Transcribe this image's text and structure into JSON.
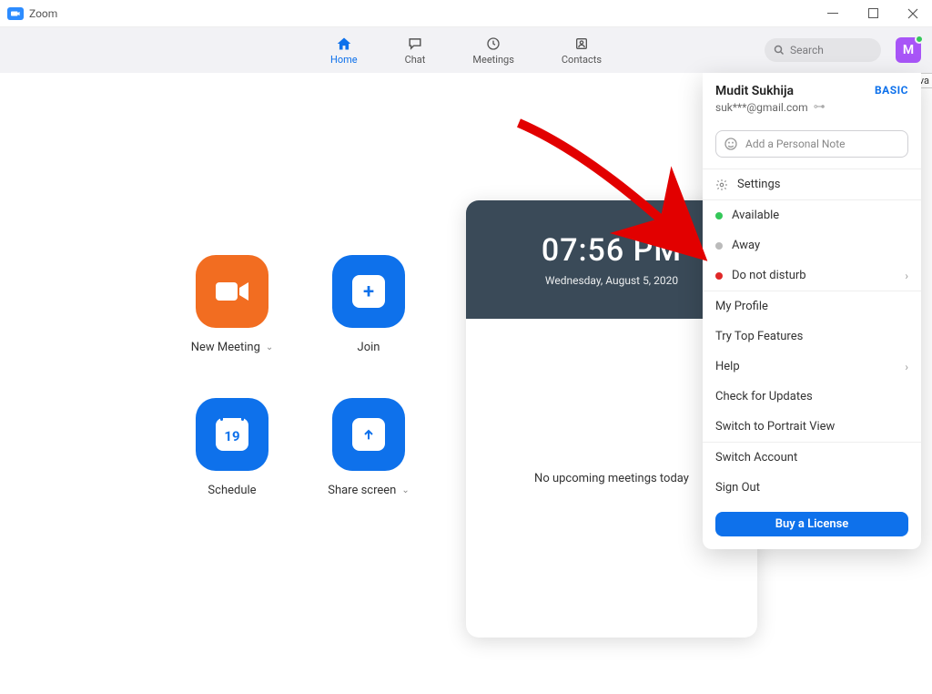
{
  "window": {
    "title": "Zoom",
    "tooltip": "Ava"
  },
  "nav": {
    "items": [
      {
        "label": "Home"
      },
      {
        "label": "Chat"
      },
      {
        "label": "Meetings"
      },
      {
        "label": "Contacts"
      }
    ],
    "search_placeholder": "Search",
    "avatar_letter": "M"
  },
  "tiles": {
    "new_meeting": "New Meeting",
    "join": "Join",
    "schedule": "Schedule",
    "schedule_day": "19",
    "share": "Share screen",
    "join_symbol": "+"
  },
  "card": {
    "time": "07:56 PM",
    "date": "Wednesday, August 5, 2020",
    "empty": "No upcoming meetings today"
  },
  "panel": {
    "name": "Mudit Sukhija",
    "plan": "BASIC",
    "email": "suk***@gmail.com",
    "note_placeholder": "Add a Personal Note",
    "settings": "Settings",
    "status": {
      "available": "Available",
      "away": "Away",
      "dnd": "Do not disturb"
    },
    "links": {
      "profile": "My Profile",
      "top_features": "Try Top Features",
      "help": "Help",
      "updates": "Check for Updates",
      "portrait": "Switch to Portrait View",
      "switch_account": "Switch Account",
      "sign_out": "Sign Out"
    },
    "cta": "Buy a License"
  }
}
